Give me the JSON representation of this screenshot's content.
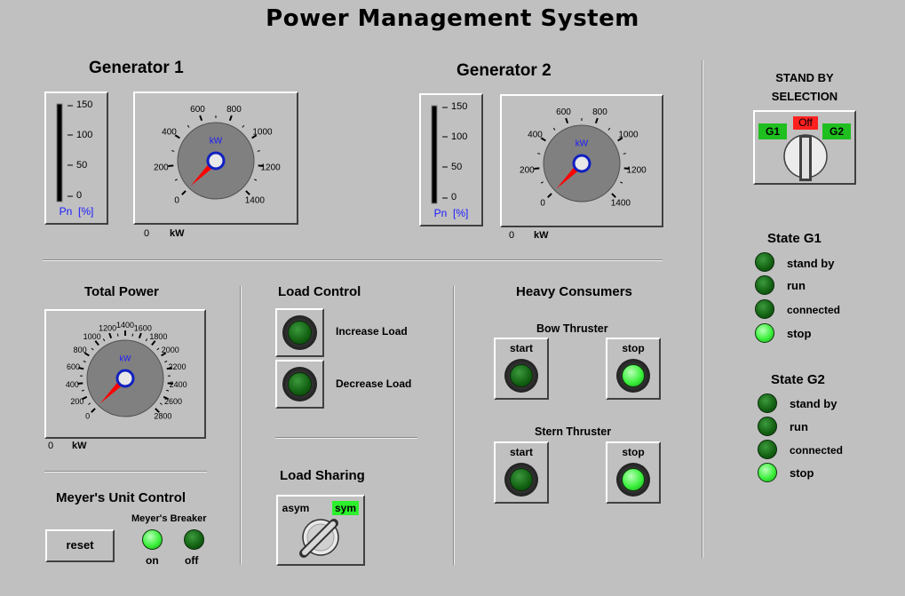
{
  "title": "Power Management System",
  "generator1": {
    "heading": "Generator 1",
    "bar": {
      "ticks": [
        "150",
        "100",
        "50",
        "0"
      ],
      "unit_label": "Pn  [%]",
      "level": 0
    },
    "dial": {
      "ticks": [
        "0",
        "200",
        "400",
        "600",
        "800",
        "1000",
        "1200",
        "1400"
      ],
      "unit": "kW",
      "max": 1400,
      "value": 0
    },
    "readout_value": "0",
    "readout_unit": "kW"
  },
  "generator2": {
    "heading": "Generator 2",
    "bar": {
      "ticks": [
        "150",
        "100",
        "50",
        "0"
      ],
      "unit_label": "Pn  [%]",
      "level": 0
    },
    "dial": {
      "ticks": [
        "0",
        "200",
        "400",
        "600",
        "800",
        "1000",
        "1200",
        "1400"
      ],
      "unit": "kW",
      "max": 1400,
      "value": 0
    },
    "readout_value": "0",
    "readout_unit": "kW"
  },
  "total_power": {
    "heading": "Total Power",
    "dial": {
      "ticks": [
        "0",
        "200",
        "400",
        "600",
        "800",
        "1000",
        "1200",
        "1400",
        "1600",
        "1800",
        "2000",
        "2200",
        "2400",
        "2600",
        "2800"
      ],
      "unit": "kW",
      "max": 2800,
      "value": 0
    },
    "readout_value": "0",
    "readout_unit": "kW"
  },
  "load_control": {
    "heading": "Load Control",
    "increase_label": "Increase Load",
    "decrease_label": "Decrease Load"
  },
  "load_sharing": {
    "heading": "Load Sharing",
    "left_label": "asym",
    "right_label": "sym",
    "selected": "sym"
  },
  "heavy_consumers": {
    "heading": "Heavy Consumers",
    "bow": {
      "label": "Bow Thruster",
      "start": "start",
      "stop": "stop"
    },
    "stern": {
      "label": "Stern Thruster",
      "start": "start",
      "stop": "stop"
    }
  },
  "meyer": {
    "heading": "Meyer's Unit Control",
    "reset_label": "reset",
    "breaker_label": "Meyer's Breaker",
    "on_label": "on",
    "off_label": "off"
  },
  "standby": {
    "heading_line1": "STAND BY",
    "heading_line2": "SELECTION",
    "g1_label": "G1",
    "off_label": "Off",
    "g2_label": "G2",
    "selected": "Off"
  },
  "state_g1": {
    "heading": "State G1",
    "items": [
      {
        "label": "stand by",
        "lit": false
      },
      {
        "label": "run",
        "lit": false
      },
      {
        "label": "connected",
        "lit": false
      },
      {
        "label": "stop",
        "lit": true
      }
    ]
  },
  "state_g2": {
    "heading": "State G2",
    "items": [
      {
        "label": "stand by",
        "lit": false
      },
      {
        "label": "run",
        "lit": false
      },
      {
        "label": "connected",
        "lit": false
      },
      {
        "label": "stop",
        "lit": true
      }
    ]
  },
  "colors": {
    "background": "#c0c0c0",
    "led_on": "#3cf03c",
    "led_off": "#126012",
    "switch_green": "#1fbf1f",
    "switch_red": "#ff2020",
    "needle": "#ff0000",
    "dial_face": "#808080",
    "hub_ring": "#1020c0",
    "unit_blue": "#1a1aff"
  }
}
